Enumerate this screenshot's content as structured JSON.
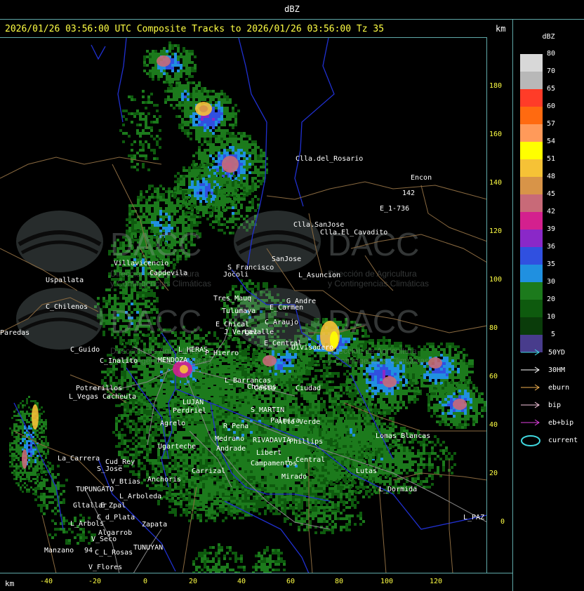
{
  "window": {
    "title": "dBZ"
  },
  "header": {
    "text": "2026/01/26 03:56:00 UTC Composite Tracks to 2026/01/26 03:56:00 Tz 35",
    "km_label": "km"
  },
  "x_axis": {
    "unit": "km",
    "ticks": [
      "-40",
      "-20",
      "0",
      "20",
      "40",
      "60",
      "80",
      "100",
      "120"
    ]
  },
  "y_axis": {
    "ticks": [
      "180",
      "160",
      "140",
      "120",
      "100",
      "80",
      "60",
      "40",
      "20",
      "0"
    ]
  },
  "legend": {
    "unit": "dBZ",
    "levels": [
      {
        "label": "80",
        "color": "#d8d8d8"
      },
      {
        "label": "70",
        "color": "#b8b8b8"
      },
      {
        "label": "65",
        "color": "#ff3c28"
      },
      {
        "label": "60",
        "color": "#ff6a10"
      },
      {
        "label": "57",
        "color": "#ff9a5a"
      },
      {
        "label": "54",
        "color": "#ffff00"
      },
      {
        "label": "51",
        "color": "#f6c236"
      },
      {
        "label": "48",
        "color": "#d89448"
      },
      {
        "label": "45",
        "color": "#c86a78"
      },
      {
        "label": "42",
        "color": "#d4208e"
      },
      {
        "label": "39",
        "color": "#8a28c8"
      },
      {
        "label": "36",
        "color": "#3050e0"
      },
      {
        "label": "35",
        "color": "#2090e0"
      },
      {
        "label": "30",
        "color": "#1c7a1c"
      },
      {
        "label": "20",
        "color": "#0e5a0e"
      },
      {
        "label": "10",
        "color": "#0a3c0a"
      },
      {
        "label": "5",
        "color": "#483c8c"
      }
    ],
    "tracks": [
      {
        "label": "50YD",
        "color": "#40d8e0"
      },
      {
        "label": "30HM",
        "color": "#ffffff"
      },
      {
        "label": "eburn",
        "color": "#f0b050"
      },
      {
        "label": "bip",
        "color": "#f8c8e0"
      },
      {
        "label": "eb+bip",
        "color": "#e040e0"
      }
    ],
    "current": {
      "label": "current",
      "color": "#40d8e0"
    }
  },
  "watermark": {
    "logo_text": "DACC",
    "line1": "Dirección de Agricultura",
    "line2": "y Contingencias Climáticas"
  },
  "places": [
    {
      "name": "Clla.del_Rosario"
    },
    {
      "name": "Encon"
    },
    {
      "name": "142"
    },
    {
      "name": "E_1-736"
    },
    {
      "name": "Clla.SanJose"
    },
    {
      "name": "Clla.El_Cavadito"
    },
    {
      "name": "Uspallata"
    },
    {
      "name": "Villavicencio"
    },
    {
      "name": "Capdevila"
    },
    {
      "name": "S_Francisco"
    },
    {
      "name": "SanJose"
    },
    {
      "name": "L_Asuncion"
    },
    {
      "name": "Jocoli"
    },
    {
      "name": "C_Chilenos"
    },
    {
      "name": "Tres_Mauq"
    },
    {
      "name": "Tulumaya"
    },
    {
      "name": "G_Andre"
    },
    {
      "name": "E_Carmen"
    },
    {
      "name": "C_Araujo"
    },
    {
      "name": "E_Chical"
    },
    {
      "name": "J_Vergel"
    },
    {
      "name": "Lavalle"
    },
    {
      "name": "Paredas"
    },
    {
      "name": "C_Guido"
    },
    {
      "name": "Divisadero"
    },
    {
      "name": "E_Central"
    },
    {
      "name": "C_Inalito"
    },
    {
      "name": "P_Hierro"
    },
    {
      "name": "MENDOZA"
    },
    {
      "name": "L_HERAS"
    },
    {
      "name": "Potrerillos"
    },
    {
      "name": "L_Vegas"
    },
    {
      "name": "Cacheuta"
    },
    {
      "name": "Ugarteche"
    },
    {
      "name": "L_Barrancas"
    },
    {
      "name": "Costa"
    },
    {
      "name": "S_MARTIN"
    },
    {
      "name": "Palmira"
    },
    {
      "name": "RIVADAVIA"
    },
    {
      "name": "Phillips"
    },
    {
      "name": "Lomas_Blancas"
    },
    {
      "name": "La_Carrera"
    },
    {
      "name": "Cud_Rey"
    },
    {
      "name": "S_Jose"
    },
    {
      "name": "V_Btias"
    },
    {
      "name": "TUPUNGATO"
    },
    {
      "name": "Anchoris"
    },
    {
      "name": "Carrizal"
    },
    {
      "name": "Campamentos"
    },
    {
      "name": "L_Central"
    },
    {
      "name": "Mirado"
    },
    {
      "name": "Lutas"
    },
    {
      "name": "L_Dormida"
    },
    {
      "name": "L_Arboleda"
    },
    {
      "name": "Gltallar"
    },
    {
      "name": "E_Zpal"
    },
    {
      "name": "L_Arbols"
    },
    {
      "name": "C_d_Plata"
    },
    {
      "name": "Zapata"
    },
    {
      "name": "V_Seco"
    },
    {
      "name": "Algarrob"
    },
    {
      "name": "Manzano"
    },
    {
      "name": "94"
    },
    {
      "name": "C_L_Rosas"
    },
    {
      "name": "TUNUYAN"
    },
    {
      "name": "V_Flores"
    },
    {
      "name": "L_PAZ"
    },
    {
      "name": "Agrelo"
    },
    {
      "name": "Perdriel"
    },
    {
      "name": "LUJAN"
    },
    {
      "name": "R_Pena"
    },
    {
      "name": "Medrano"
    },
    {
      "name": "Andrade"
    },
    {
      "name": "Libert"
    },
    {
      "name": "Ciudad"
    },
    {
      "name": "Chimbas"
    },
    {
      "name": "Alto_Verde"
    }
  ]
}
